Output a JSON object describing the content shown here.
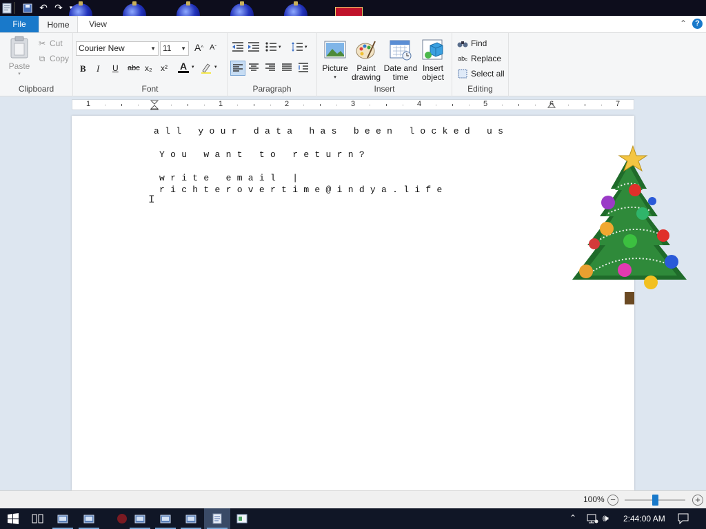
{
  "tabs": {
    "file": "File",
    "home": "Home",
    "view": "View"
  },
  "clipboard": {
    "paste": "Paste",
    "cut": "Cut",
    "copy": "Copy",
    "group": "Clipboard"
  },
  "font": {
    "family": "Courier New",
    "size": "11",
    "group": "Font",
    "bold": "B",
    "italic": "I",
    "underline": "U",
    "strike": "abc",
    "subscript": "x₂",
    "superscript": "x²",
    "grow": "A",
    "shrink": "A"
  },
  "paragraph": {
    "group": "Paragraph"
  },
  "insert": {
    "picture": "Picture",
    "paint_1": "Paint",
    "paint_2": "drawing",
    "datetime_1": "Date and",
    "datetime_2": "time",
    "object_1": "Insert",
    "object_2": "object",
    "group": "Insert"
  },
  "editing": {
    "find": "Find",
    "replace": "Replace",
    "select_all": "Select all",
    "group": "Editing"
  },
  "ruler": {
    "numbers": [
      "1",
      "1",
      "2",
      "3",
      "4",
      "5",
      "6",
      "7"
    ]
  },
  "document": {
    "line1": "all your data has been locked us",
    "line2": "You want to return?",
    "line3": "write email |",
    "line4": "richterovertime@indya.life"
  },
  "status": {
    "zoom": "100%",
    "minus": "−",
    "plus": "+"
  },
  "taskbar": {
    "time": "2:44:00 AM"
  },
  "colors": {
    "accent": "#1979ca",
    "taskbar": "#101626"
  }
}
